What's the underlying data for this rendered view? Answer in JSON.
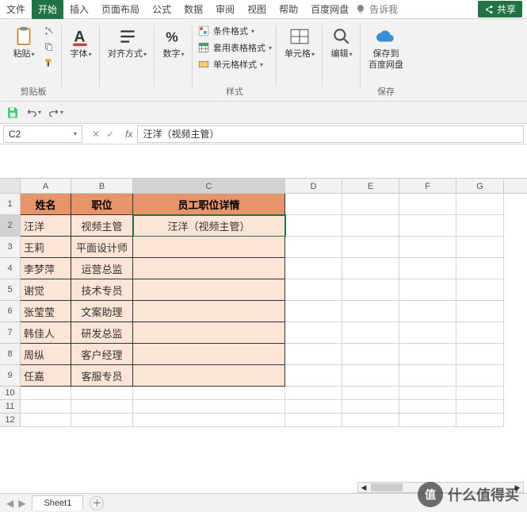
{
  "menubar": {
    "tabs": [
      "文件",
      "开始",
      "插入",
      "页面布局",
      "公式",
      "数据",
      "审阅",
      "视图",
      "帮助",
      "百度网盘"
    ],
    "active": 1,
    "tell_me": "告诉我",
    "share": "共享"
  },
  "ribbon": {
    "clipboard": {
      "paste": "粘贴",
      "group": "剪贴板"
    },
    "font": {
      "label": "字体",
      "group": ""
    },
    "align": {
      "label": "对齐方式"
    },
    "number": {
      "label": "数字"
    },
    "styles": {
      "cond": "条件格式",
      "table": "套用表格格式",
      "cell": "单元格样式",
      "group": "样式"
    },
    "cells": {
      "label": "单元格"
    },
    "editing": {
      "label": "编辑"
    },
    "save": {
      "label1": "保存到",
      "label2": "百度网盘",
      "group": "保存"
    }
  },
  "namebox": "C2",
  "formula": "汪洋（视频主管）",
  "columns": [
    "A",
    "B",
    "C",
    "D",
    "E",
    "F",
    "G"
  ],
  "active_cell": {
    "row": 2,
    "col": "C"
  },
  "table": {
    "headers": [
      "姓名",
      "职位",
      "员工职位详情"
    ],
    "rows": [
      [
        "汪洋",
        "视频主管",
        "汪洋（视频主管）"
      ],
      [
        "王莉",
        "平面设计师",
        ""
      ],
      [
        "李梦萍",
        "运营总监",
        ""
      ],
      [
        "谢觉",
        "技术专员",
        ""
      ],
      [
        "张莹莹",
        "文案助理",
        ""
      ],
      [
        "韩佳人",
        "研发总监",
        ""
      ],
      [
        "周纵",
        "客户经理",
        ""
      ],
      [
        "任嘉",
        "客服专员",
        ""
      ]
    ]
  },
  "sheet_tab": "Sheet1",
  "watermark": {
    "logo": "值",
    "text": "什么值得买"
  }
}
